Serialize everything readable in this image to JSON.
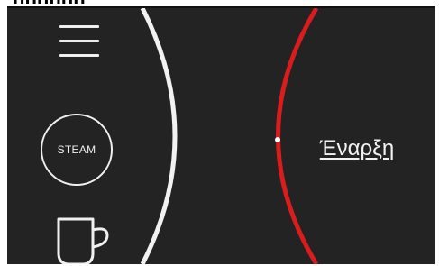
{
  "header": {
    "cropped_title": "hhhhhh"
  },
  "panel": {
    "menu_icon": "hamburger-menu-icon",
    "steam_label": "STEAM",
    "cup_icon": "coffee-cup-icon",
    "start_label": "Έναρξη"
  },
  "colors": {
    "background": "#232323",
    "white_arc": "#f2f2f2",
    "red_arc": "#d91c1c",
    "text": "#f3f3f3"
  }
}
